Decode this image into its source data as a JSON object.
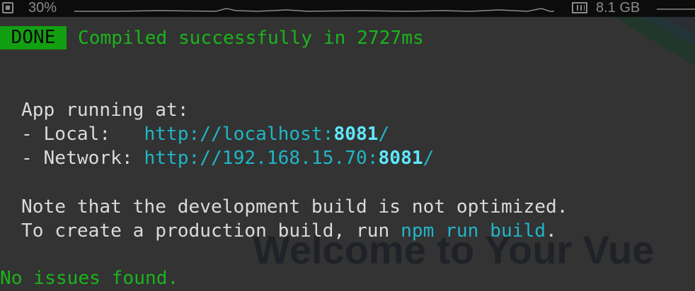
{
  "statusbar": {
    "cpu_icon": "cpu-chip-icon",
    "cpu_value": "30%",
    "memory_icon": "memory-icon",
    "memory_value": "8.1 GB"
  },
  "background": {
    "welcome_text": "Welcome to Your Vue"
  },
  "terminal": {
    "badge": "DONE",
    "compiled_message": "Compiled successfully in 2727ms",
    "app_running": "App running at:",
    "local_label": "- Local:   ",
    "local_url_prefix": "http://localhost:",
    "local_port": "8081",
    "local_url_suffix": "/",
    "network_label": "- Network: ",
    "network_url_prefix": "http://192.168.15.70:",
    "network_port": "8081",
    "network_url_suffix": "/",
    "note_line": "Note that the development build is not optimized.",
    "create_prefix": "To create a production build, run ",
    "create_command": "npm run build",
    "create_suffix": ".",
    "issues": "No issues found."
  },
  "colors": {
    "terminal_bg": "#333333",
    "status_bar_bg": "#0c0c0c",
    "done_badge_bg": "#12a012",
    "success_green": "#1bb41b",
    "url_cyan": "#21b5c6",
    "port_cyan": "#5fe8ff",
    "vue_green": "#42b883",
    "vue_navy": "#35495e"
  }
}
